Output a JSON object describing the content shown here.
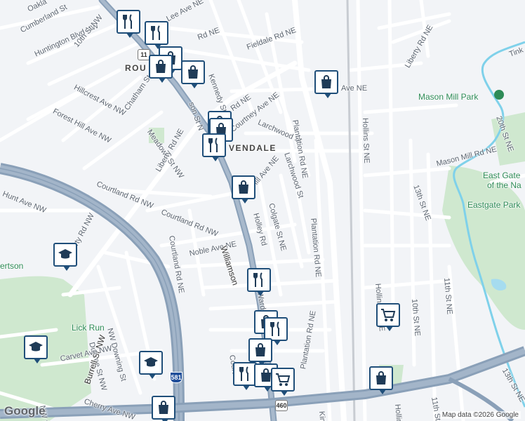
{
  "map": {
    "labels": {
      "oakland": "Oakla",
      "cumberland_st": "Cumberland St",
      "huntington_blvd": "Huntington Blvd NW",
      "tenth_st_nw": "10th St NW",
      "roundhill": "ROU",
      "lee_ave": "Lee Ave NE",
      "fieldale_rd": "Fieldale Rd NE",
      "kennedy_st": "Kennedy St",
      "hillcrest_ave": "Hillcrest Ave NW",
      "forest_hill_ave": "Forest Hill Ave NW",
      "chatham_st": "Chatham St NW",
      "meadows_st": "Meadows St NW",
      "courtney_ave": "Courtney Ave NE",
      "larchwood_st": "Larchwood St",
      "plantation_rd_top": "Plantation Rd NE",
      "plantation_rd_mid": "Plantation Rd NE",
      "plantation_rd_bottom": "Plantation Rd NE",
      "liberty_rd_top": "Liberty Rd NE",
      "liberty_rd_nw": "Liberty Rd NW",
      "liberty_rd_east": "Liberty Rd NE",
      "vendale": "VENDALE",
      "courtland_rd_nw": "Courtland Rd NW",
      "hunt_ave": "Hunt Ave NW",
      "courtland_rd_nw2": "Courtland Rd NW",
      "courtland_rd_ne": "Courtland Rd NE",
      "hill_ave": "Hill Ave NE",
      "holley_rd": "Holley Rd",
      "colgate_st": "Colgate St NE",
      "noble_ave": "Noble Ave NE",
      "williamson": "Williamson",
      "ward_st": "Ward St NE",
      "hollins_st": "Hollins St NE",
      "hollins_rd": "Hollins Rd NE",
      "mason_mill_park": "Mason Mill Park",
      "mason_mill_rd": "Mason Mill Rd NE",
      "east_gate_1": "East Gate",
      "east_gate_2": "of the Na",
      "eastgate_park": "Eastgate Park",
      "twentieth_st": "20th St NE",
      "thirteenth_st": "13th St NE",
      "tenth_st_ne": "10th St NE",
      "eleventh_st": "11th St NE",
      "eleventh_st_2": "11th St",
      "thirteenth_st_2": "13th St NE",
      "tink": "Tink",
      "robertson": "ertson",
      "lick_run": "Lick Run",
      "nw_downing": "NW Downing St",
      "dupree_st": "Dupree St NW",
      "burrell_st": "Burrell St NW",
      "carvet_ave": "Carvet Ave NW",
      "cherry_ave": "Cherry Ave NW",
      "courtland_bottom": "Courtla",
      "kin": "Kin",
      "hollins_bottom": "Hollins",
      "nw_st": "NW St",
      "mason_st": "son St N",
      "ave_ne_top": "Ave NE",
      "rd_ne_kennedy": "Rd NE",
      "rd_ne_top": "Rd NE"
    },
    "shields": {
      "us11": "11",
      "i581": "581",
      "us460": "460"
    },
    "icons": {
      "restaurant": "fork-knife-icon",
      "shopping": "shopping-bag-icon",
      "grocery": "shopping-cart-icon",
      "school": "graduation-cap-icon",
      "park": "tree-icon"
    },
    "colors": {
      "pin_border": "#1f4e79",
      "highway": "#8aa0b8",
      "park": "#cfe8cf",
      "water": "#7fd1ea"
    },
    "logo": "Google",
    "attribution": "Map data ©2026 Google"
  }
}
